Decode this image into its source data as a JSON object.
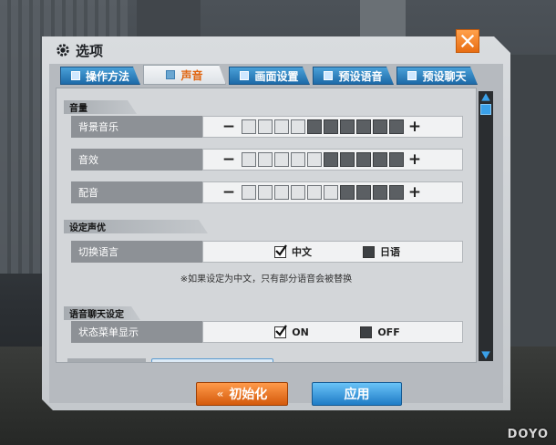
{
  "window": {
    "title": "选项"
  },
  "tabs": [
    {
      "label": "操作方法",
      "active": false
    },
    {
      "label": "声音",
      "active": true
    },
    {
      "label": "画面设置",
      "active": false
    },
    {
      "label": "预设语音",
      "active": false
    },
    {
      "label": "预设聊天",
      "active": false
    }
  ],
  "volume": {
    "section_title": "音量",
    "rows": [
      {
        "label": "背景音乐",
        "level": 4,
        "max": 10
      },
      {
        "label": "音效",
        "level": 5,
        "max": 10
      },
      {
        "label": "配音",
        "level": 6,
        "max": 10
      }
    ],
    "minus_symbol": "−",
    "plus_symbol": "+"
  },
  "voice_actor": {
    "section_title": "设定声优",
    "row_label": "切换语言",
    "option_chinese": "中文",
    "option_japanese": "日语",
    "selected": "中文",
    "note": "※如果设定为中文，只有部分语音会被替换"
  },
  "voice_chat": {
    "section_title": "语音聊天设定",
    "row_label": "状态菜单显示",
    "option_on": "ON",
    "option_off": "OFF",
    "selected": "ON"
  },
  "buttons": {
    "init": "初始化",
    "apply": "应用"
  },
  "watermark": "DOYO",
  "colors": {
    "accent_orange": "#e86d12",
    "accent_blue": "#1f7cc6"
  }
}
